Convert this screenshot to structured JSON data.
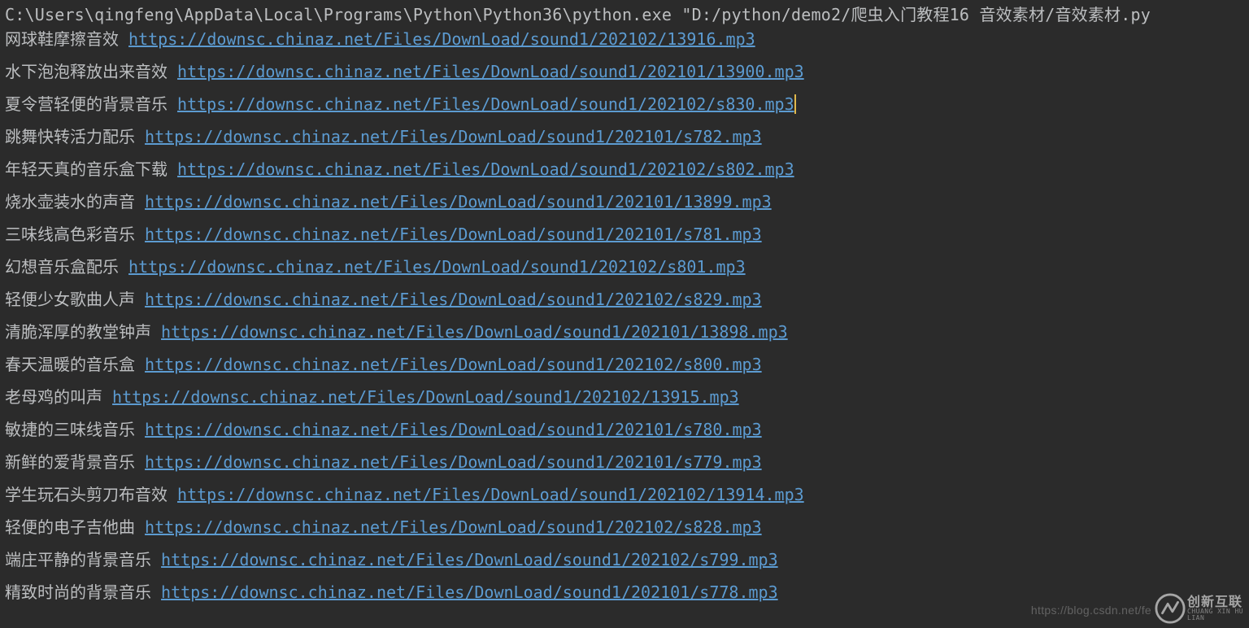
{
  "command_line": "C:\\Users\\qingfeng\\AppData\\Local\\Programs\\Python\\Python36\\python.exe \"D:/python/demo2/爬虫入门教程16 音效素材/音效素材.py",
  "cursor_row_index": 2,
  "output_rows": [
    {
      "label": "网球鞋摩擦音效",
      "url": "https://downsc.chinaz.net/Files/DownLoad/sound1/202102/13916.mp3"
    },
    {
      "label": "水下泡泡释放出来音效",
      "url": "https://downsc.chinaz.net/Files/DownLoad/sound1/202101/13900.mp3"
    },
    {
      "label": "夏令营轻便的背景音乐",
      "url": "https://downsc.chinaz.net/Files/DownLoad/sound1/202102/s830.mp3"
    },
    {
      "label": "跳舞快转活力配乐",
      "url": "https://downsc.chinaz.net/Files/DownLoad/sound1/202101/s782.mp3"
    },
    {
      "label": "年轻天真的音乐盒下载",
      "url": "https://downsc.chinaz.net/Files/DownLoad/sound1/202102/s802.mp3"
    },
    {
      "label": "烧水壶装水的声音",
      "url": "https://downsc.chinaz.net/Files/DownLoad/sound1/202101/13899.mp3"
    },
    {
      "label": "三味线高色彩音乐",
      "url": "https://downsc.chinaz.net/Files/DownLoad/sound1/202101/s781.mp3"
    },
    {
      "label": "幻想音乐盒配乐",
      "url": "https://downsc.chinaz.net/Files/DownLoad/sound1/202102/s801.mp3"
    },
    {
      "label": "轻便少女歌曲人声",
      "url": "https://downsc.chinaz.net/Files/DownLoad/sound1/202102/s829.mp3"
    },
    {
      "label": "清脆浑厚的教堂钟声",
      "url": "https://downsc.chinaz.net/Files/DownLoad/sound1/202101/13898.mp3"
    },
    {
      "label": "春天温暖的音乐盒",
      "url": "https://downsc.chinaz.net/Files/DownLoad/sound1/202102/s800.mp3"
    },
    {
      "label": "老母鸡的叫声",
      "url": "https://downsc.chinaz.net/Files/DownLoad/sound1/202102/13915.mp3"
    },
    {
      "label": "敏捷的三味线音乐",
      "url": "https://downsc.chinaz.net/Files/DownLoad/sound1/202101/s780.mp3"
    },
    {
      "label": "新鲜的爱背景音乐",
      "url": "https://downsc.chinaz.net/Files/DownLoad/sound1/202101/s779.mp3"
    },
    {
      "label": "学生玩石头剪刀布音效",
      "url": "https://downsc.chinaz.net/Files/DownLoad/sound1/202102/13914.mp3"
    },
    {
      "label": "轻便的电子吉他曲",
      "url": "https://downsc.chinaz.net/Files/DownLoad/sound1/202102/s828.mp3"
    },
    {
      "label": "端庄平静的背景音乐",
      "url": "https://downsc.chinaz.net/Files/DownLoad/sound1/202102/s799.mp3"
    },
    {
      "label": "精致时尚的背景音乐",
      "url": "https://downsc.chinaz.net/Files/DownLoad/sound1/202101/s778.mp3"
    }
  ],
  "watermark": {
    "blog_text": "https://blog.csdn.net/fe",
    "logo_cn": "创新互联",
    "logo_en": "CHUANG XIN HU LIAN"
  }
}
